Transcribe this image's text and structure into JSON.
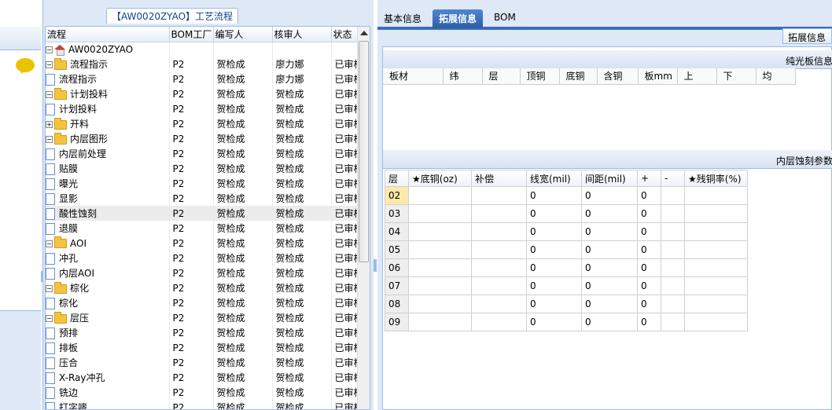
{
  "mid_panel": {
    "title": "【AW0020ZYAO】工艺流程",
    "columns": [
      "流程",
      "BOM工厂",
      "编写人",
      "核审人",
      "状态"
    ],
    "rows": [
      {
        "label": "AW0020ZYAO",
        "kind": "root",
        "indent": 0,
        "expander": "−",
        "bom": "",
        "writer": "",
        "reviewer": "",
        "status": ""
      },
      {
        "label": "流程指示",
        "kind": "folder",
        "indent": 1,
        "expander": "−",
        "bom": "P2",
        "writer": "贺检成",
        "reviewer": "廖力娜",
        "status": "已审核"
      },
      {
        "label": "流程指示",
        "kind": "file",
        "indent": 2,
        "expander": "",
        "bom": "P2",
        "writer": "贺检成",
        "reviewer": "廖力娜",
        "status": "已审核"
      },
      {
        "label": "计划投料",
        "kind": "folder",
        "indent": 1,
        "expander": "−",
        "bom": "P2",
        "writer": "贺检成",
        "reviewer": "贺检成",
        "status": "已审核"
      },
      {
        "label": "计划投料",
        "kind": "file",
        "indent": 2,
        "expander": "",
        "bom": "P2",
        "writer": "贺检成",
        "reviewer": "贺检成",
        "status": "已审核"
      },
      {
        "label": "开料",
        "kind": "folder",
        "indent": 1,
        "expander": "+",
        "bom": "P2",
        "writer": "贺检成",
        "reviewer": "贺检成",
        "status": "已审核"
      },
      {
        "label": "内层图形",
        "kind": "folder",
        "indent": 1,
        "expander": "−",
        "bom": "P2",
        "writer": "贺检成",
        "reviewer": "贺检成",
        "status": "已审核"
      },
      {
        "label": "内层前处理",
        "kind": "file",
        "indent": 2,
        "expander": "",
        "bom": "P2",
        "writer": "贺检成",
        "reviewer": "贺检成",
        "status": "已审核"
      },
      {
        "label": "贴膜",
        "kind": "file",
        "indent": 2,
        "expander": "",
        "bom": "P2",
        "writer": "贺检成",
        "reviewer": "贺检成",
        "status": "已审核"
      },
      {
        "label": "曝光",
        "kind": "file",
        "indent": 2,
        "expander": "",
        "bom": "P2",
        "writer": "贺检成",
        "reviewer": "贺检成",
        "status": "已审核"
      },
      {
        "label": "显影",
        "kind": "file",
        "indent": 2,
        "expander": "",
        "bom": "P2",
        "writer": "贺检成",
        "reviewer": "贺检成",
        "status": "已审核"
      },
      {
        "label": "酸性蚀刻",
        "kind": "file",
        "indent": 2,
        "expander": "",
        "bom": "P2",
        "writer": "贺检成",
        "reviewer": "贺检成",
        "status": "已审核",
        "selected": true
      },
      {
        "label": "退膜",
        "kind": "file",
        "indent": 2,
        "expander": "",
        "bom": "P2",
        "writer": "贺检成",
        "reviewer": "贺检成",
        "status": "已审核"
      },
      {
        "label": "AOI",
        "kind": "folder",
        "indent": 1,
        "expander": "−",
        "bom": "P2",
        "writer": "贺检成",
        "reviewer": "贺检成",
        "status": "已审核"
      },
      {
        "label": "冲孔",
        "kind": "file",
        "indent": 2,
        "expander": "",
        "bom": "P2",
        "writer": "贺检成",
        "reviewer": "贺检成",
        "status": "已审核"
      },
      {
        "label": "内层AOI",
        "kind": "file",
        "indent": 2,
        "expander": "",
        "bom": "P2",
        "writer": "贺检成",
        "reviewer": "贺检成",
        "status": "已审核"
      },
      {
        "label": "棕化",
        "kind": "folder",
        "indent": 1,
        "expander": "−",
        "bom": "P2",
        "writer": "贺检成",
        "reviewer": "贺检成",
        "status": "已审核"
      },
      {
        "label": "棕化",
        "kind": "file",
        "indent": 2,
        "expander": "",
        "bom": "P2",
        "writer": "贺检成",
        "reviewer": "贺检成",
        "status": "已审核"
      },
      {
        "label": "层压",
        "kind": "folder",
        "indent": 1,
        "expander": "−",
        "bom": "P2",
        "writer": "贺检成",
        "reviewer": "贺检成",
        "status": "已审核"
      },
      {
        "label": "预排",
        "kind": "file",
        "indent": 2,
        "expander": "",
        "bom": "P2",
        "writer": "贺检成",
        "reviewer": "贺检成",
        "status": "已审核"
      },
      {
        "label": "排板",
        "kind": "file",
        "indent": 2,
        "expander": "",
        "bom": "P2",
        "writer": "贺检成",
        "reviewer": "贺检成",
        "status": "已审核"
      },
      {
        "label": "压合",
        "kind": "file",
        "indent": 2,
        "expander": "",
        "bom": "P2",
        "writer": "贺检成",
        "reviewer": "贺检成",
        "status": "已审核"
      },
      {
        "label": "X-Ray冲孔",
        "kind": "file",
        "indent": 2,
        "expander": "",
        "bom": "P2",
        "writer": "贺检成",
        "reviewer": "贺检成",
        "status": "已审核"
      },
      {
        "label": "铣边",
        "kind": "file",
        "indent": 2,
        "expander": "",
        "bom": "P2",
        "writer": "贺检成",
        "reviewer": "贺检成",
        "status": "已审核"
      },
      {
        "label": "打字嘜",
        "kind": "file",
        "indent": 2,
        "expander": "",
        "bom": "P2",
        "writer": "贺检成",
        "reviewer": "贺检成",
        "status": "已审核"
      }
    ]
  },
  "right_panel": {
    "tabs": [
      "基本信息",
      "拓展信息",
      "BOM"
    ],
    "active_tab": 1,
    "subtab": "拓展信息",
    "section1_title": "纯光板信息",
    "section1_columns": [
      "板材",
      "纬",
      "层",
      "顶铜",
      "底铜",
      "含铜",
      "板mm",
      "上",
      "下",
      "均"
    ],
    "section2_title": "内层蚀刻参数",
    "section2_columns": [
      "层",
      "★底铜(oz)",
      "补偿",
      "线宽(mil)",
      "间距(mil)",
      "+",
      "-",
      "★残铜率(%)"
    ],
    "section2_rows": [
      [
        "02",
        "",
        "",
        "0",
        "0",
        "0",
        "",
        ""
      ],
      [
        "03",
        "",
        "",
        "0",
        "0",
        "0",
        "",
        ""
      ],
      [
        "04",
        "",
        "",
        "0",
        "0",
        "0",
        "",
        ""
      ],
      [
        "05",
        "",
        "",
        "0",
        "0",
        "0",
        "",
        ""
      ],
      [
        "06",
        "",
        "",
        "0",
        "0",
        "0",
        "",
        ""
      ],
      [
        "07",
        "",
        "",
        "0",
        "0",
        "0",
        "",
        ""
      ],
      [
        "08",
        "",
        "",
        "0",
        "0",
        "0",
        "",
        ""
      ],
      [
        "09",
        "",
        "",
        "0",
        "0",
        "0",
        "",
        ""
      ]
    ]
  }
}
